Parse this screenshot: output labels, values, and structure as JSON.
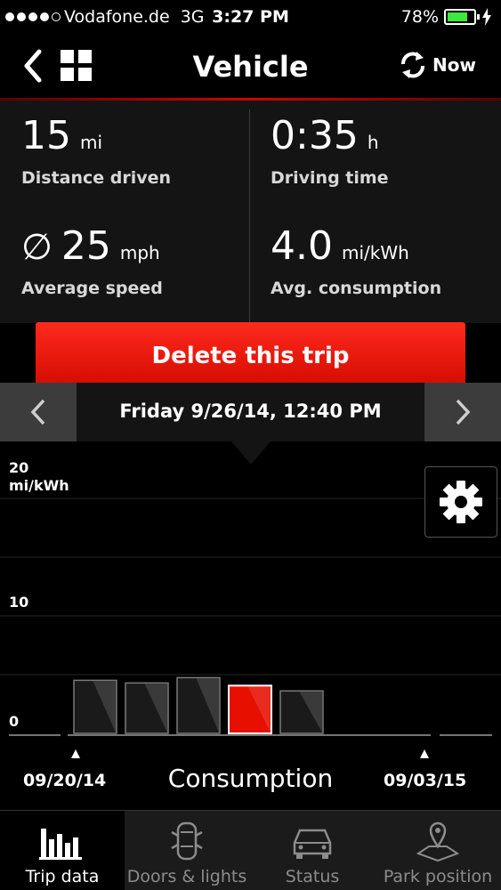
{
  "status_bar": {
    "carrier": "Vodafone.de",
    "network": "3G",
    "time": "3:27 PM",
    "battery": "78%",
    "battery_level": 0.78,
    "battery_color": "#3ee83e"
  },
  "nav": {
    "title": "Vehicle",
    "refresh_label": "Now",
    "back_icon": "chevron-left-icon",
    "grid_icon": "grid-icon",
    "refresh_icon": "refresh-icon"
  },
  "stats": {
    "distance": {
      "value": "15",
      "unit": "mi",
      "label": "Distance driven"
    },
    "time": {
      "value": "0:35",
      "unit": "h",
      "label": "Driving time"
    },
    "speed": {
      "symbol": "∅",
      "value": "25",
      "unit": "mph",
      "label": "Average speed"
    },
    "consumption": {
      "value": "4.0",
      "unit": "mi/kWh",
      "label": "Avg. consumption"
    }
  },
  "delete_button": "Delete this trip",
  "accent_color": "#e60f00",
  "date_bar": {
    "date": "Friday 9/26/14, 12:40 PM"
  },
  "chart_data": {
    "type": "bar",
    "title": "Consumption",
    "ylabel": "mi/kWh",
    "ylim": [
      0,
      20
    ],
    "y_ticks": [
      "20",
      "10",
      "0"
    ],
    "values": [
      4.0,
      3.8,
      4.2,
      3.6,
      3.2
    ],
    "selected_index": 3,
    "x_range": {
      "start": "09/20/14",
      "end": "09/03/15"
    }
  },
  "tabs": [
    {
      "label": "Trip data",
      "icon": "bar-chart-icon",
      "active": true
    },
    {
      "label": "Doors & lights",
      "icon": "car-top-icon",
      "active": false
    },
    {
      "label": "Status",
      "icon": "car-front-icon",
      "active": false
    },
    {
      "label": "Park position",
      "icon": "map-pin-icon",
      "active": false
    }
  ]
}
